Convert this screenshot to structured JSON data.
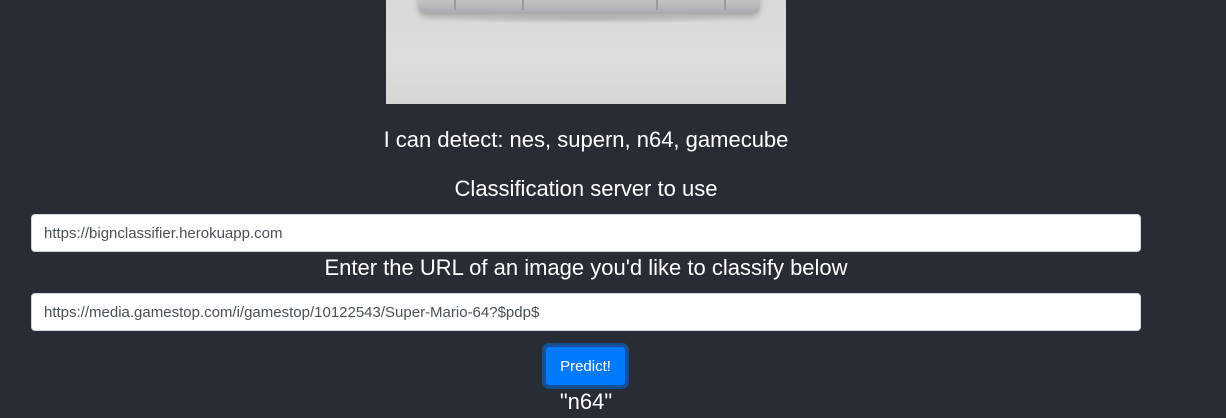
{
  "detect": {
    "text": "I can detect: nes, supern, n64, gamecube"
  },
  "server": {
    "label": "Classification server to use",
    "value": "https://bignclassifier.herokuapp.com"
  },
  "image_url": {
    "label": "Enter the URL of an image you'd like to classify below",
    "value": "https://media.gamestop.com/i/gamestop/10122543/Super-Mario-64?$pdp$"
  },
  "predict": {
    "label": "Predict!"
  },
  "result": {
    "text": "\"n64\""
  },
  "colors": {
    "background": "#282c34",
    "button": "#007bff",
    "text": "#ffffff"
  }
}
